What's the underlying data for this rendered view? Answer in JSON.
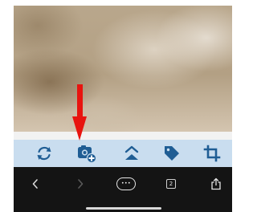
{
  "photo": {
    "description_icon": "photo-preview"
  },
  "toolbar": {
    "accent_color": "#1f5d94",
    "background_color": "#c9ddef",
    "items": [
      {
        "name": "rotate",
        "icon": "rotate-icon"
      },
      {
        "name": "add-photo",
        "icon": "camera-add-icon"
      },
      {
        "name": "enhance",
        "icon": "chevron-up-icon"
      },
      {
        "name": "tag",
        "icon": "tag-icon"
      },
      {
        "name": "crop",
        "icon": "crop-icon"
      }
    ]
  },
  "annotation": {
    "arrow_color": "#e8140f",
    "arrow_icon": "red-arrow-down"
  },
  "browser_bar": {
    "back_icon": "chevron-left-icon",
    "forward_icon": "chevron-right-icon",
    "menu_label": "•••",
    "tabs_count": "2",
    "share_icon": "share-icon"
  }
}
